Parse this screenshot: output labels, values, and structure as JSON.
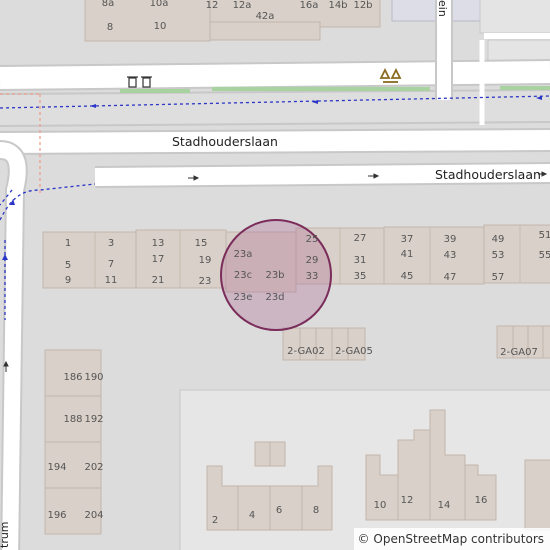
{
  "map": {
    "background": "#dcdcdc",
    "colors": {
      "building": "#d9d0c9",
      "building_stroke": "#c4b6ab",
      "road": "#ffffff",
      "road_casing": "#c8c8c8",
      "path_dotted": "#2b35c7",
      "path_pink": "#f0a08c",
      "grass": "#a8d3a0",
      "pedestrian": "#dddde8",
      "marker_fill": "#b4789a",
      "marker_stroke": "#7a2c5a",
      "label": "#444444"
    },
    "streets": [
      {
        "id": "stadhouderslaan-north",
        "label": "Stadhouderslaan"
      },
      {
        "id": "stadhouderslaan-south",
        "label": "Stadhouderslaan"
      },
      {
        "id": "vertical-west",
        "label": "trum"
      },
      {
        "id": "vertical-north",
        "label": "ein"
      }
    ],
    "house_numbers": {
      "top_row": [
        "8a",
        "10a",
        "12",
        "12a",
        "16a",
        "14b",
        "12b",
        "8",
        "10",
        "42a"
      ],
      "middle_row": [
        "1",
        "3",
        "5",
        "7",
        "9",
        "11",
        "13",
        "15",
        "17",
        "19",
        "21",
        "23",
        "23a",
        "23c",
        "23b",
        "23e",
        "23d",
        "25",
        "27",
        "29",
        "31",
        "33",
        "35",
        "37",
        "39",
        "41",
        "43",
        "45",
        "47",
        "49",
        "51",
        "53",
        "55",
        "57"
      ],
      "garages": [
        "2-GA02",
        "2-GA05",
        "2-GA07"
      ],
      "west_block": [
        "186",
        "190",
        "188",
        "192",
        "194",
        "202",
        "196",
        "204"
      ],
      "south_row": [
        "2",
        "4",
        "6",
        "8",
        "10",
        "12",
        "14",
        "16"
      ]
    },
    "icons": [
      "waste-basket-icon",
      "recycling-icon",
      "one-way-arrow-icon"
    ],
    "attribution": {
      "symbol": "©",
      "text": "OpenStreetMap contributors"
    }
  }
}
